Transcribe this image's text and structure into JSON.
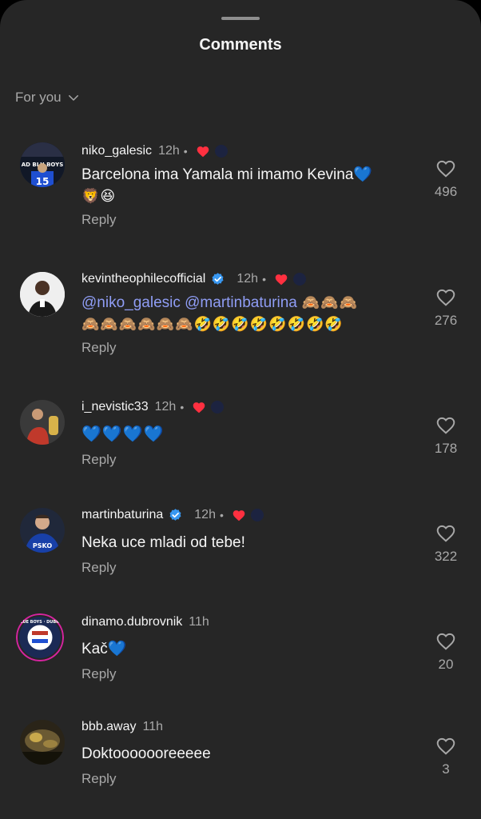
{
  "header": {
    "title": "Comments"
  },
  "filter": {
    "label": "For you"
  },
  "comments": [
    {
      "username": "niko_galesic",
      "time": "12h",
      "verified": false,
      "liked_by_author": true,
      "text": "Barcelona ima Yamala mi imamo Kevina💙",
      "text2": "🦁😆",
      "mentions": "",
      "reply": "Reply",
      "likes": "496"
    },
    {
      "username": "kevintheophilecofficial",
      "time": "12h",
      "verified": true,
      "liked_by_author": true,
      "mentions": "@niko_galesic @martinbaturina",
      "text": " 🙈🙈🙈",
      "text2": "🙈🙈🙈🙈🙈🙈🤣🤣🤣🤣🤣🤣🤣🤣",
      "reply": "Reply",
      "likes": "276"
    },
    {
      "username": "i_nevistic33",
      "time": "12h",
      "verified": false,
      "liked_by_author": true,
      "text": "💙💙💙💙",
      "text2": "",
      "mentions": "",
      "reply": "Reply",
      "likes": "178"
    },
    {
      "username": "martinbaturina",
      "time": "12h",
      "verified": true,
      "liked_by_author": true,
      "text": "Neka uce mladi od tebe!",
      "text2": "",
      "mentions": "",
      "reply": "Reply",
      "likes": "322"
    },
    {
      "username": "dinamo.dubrovnik",
      "time": "11h",
      "verified": false,
      "liked_by_author": false,
      "text": "Kač💙",
      "text2": "",
      "mentions": "",
      "reply": "Reply",
      "likes": "20"
    },
    {
      "username": "bbb.away",
      "time": "11h",
      "verified": false,
      "liked_by_author": false,
      "text": "Doktooooooreeeee",
      "text2": "",
      "mentions": "",
      "reply": "Reply",
      "likes": "3"
    }
  ],
  "icons": {
    "like": "heart-outline-icon",
    "filter_chevron": "chevron-down-icon",
    "verified": "verified-badge-icon"
  },
  "colors": {
    "background": "#262626",
    "accent_heart": "#ff3040",
    "verified": "#3897f0",
    "mention": "#8f9df5"
  },
  "avatar_badges": {
    "niko_galesic": "AD BLU BOYS",
    "dinamo.dubrovnik_ring": "BAD BLUE BOYS · DUBROVNIK"
  }
}
